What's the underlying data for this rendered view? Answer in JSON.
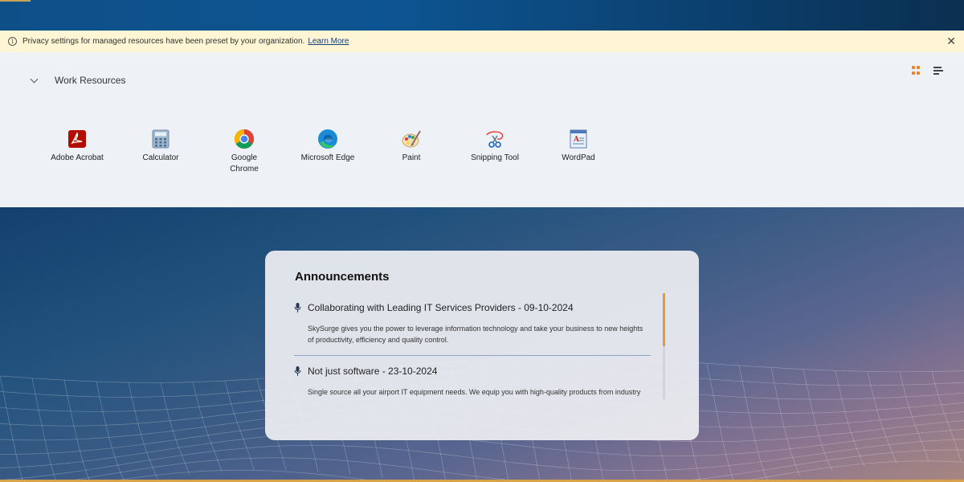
{
  "notice": {
    "text": "Privacy settings for managed resources have been preset by your organization.",
    "link": "Learn More",
    "close": "✕",
    "info": "i"
  },
  "resources": {
    "title": "Work Resources",
    "apps": [
      {
        "label": "Adobe Acrobat",
        "icon": "adobe-acrobat-icon"
      },
      {
        "label": "Calculator",
        "icon": "calculator-icon"
      },
      {
        "label": "Google Chrome",
        "icon": "chrome-icon"
      },
      {
        "label": "Microsoft Edge",
        "icon": "edge-icon"
      },
      {
        "label": "Paint",
        "icon": "paint-icon"
      },
      {
        "label": "Snipping Tool",
        "icon": "snipping-tool-icon"
      },
      {
        "label": "WordPad",
        "icon": "wordpad-icon"
      }
    ]
  },
  "announcements": {
    "title": "Announcements",
    "items": [
      {
        "title": "Collaborating with Leading IT Services Providers - 09-10-2024",
        "body": "SkySurge gives you the power to leverage information technology and take your business to new heights of productivity, efficiency and quality control."
      },
      {
        "title": "Not just software - 23-10-2024",
        "body": "Single source all your airport IT equipment needs. We equip you with high-quality products from industry"
      }
    ]
  },
  "colors": {
    "accent": "#f0832a",
    "notice_bg": "#fdf5d3",
    "scroll_thumb": "#e99a36"
  }
}
